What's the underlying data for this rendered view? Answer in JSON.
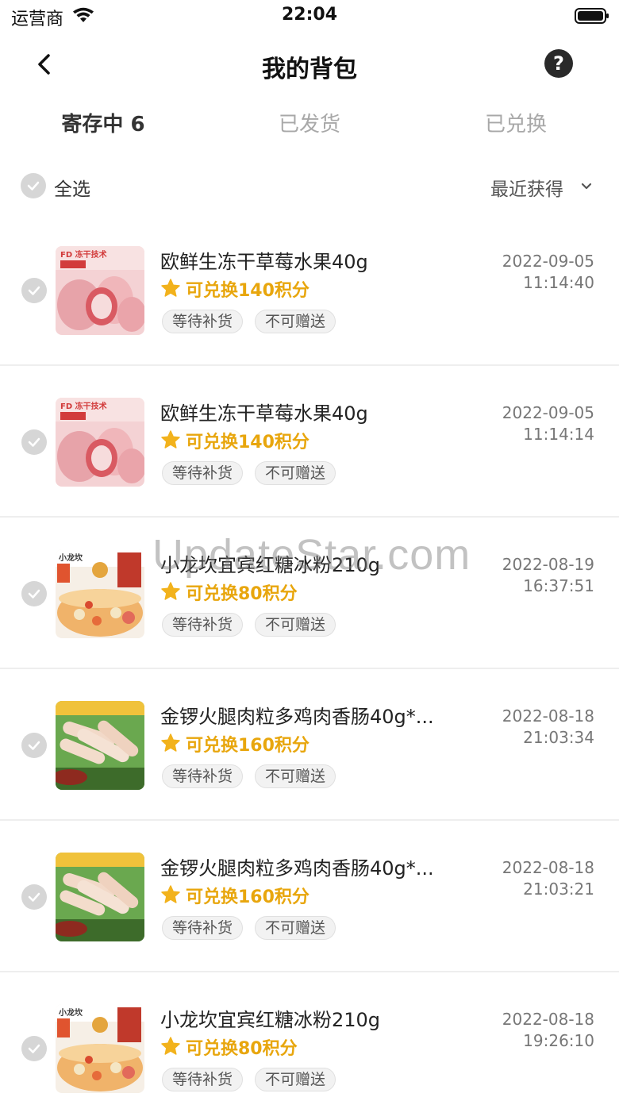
{
  "status_bar": {
    "carrier": "运营商",
    "time": "22:04"
  },
  "nav": {
    "title": "我的背包",
    "help_glyph": "?"
  },
  "tabs": [
    {
      "label": "寄存中 6",
      "active": true
    },
    {
      "label": "已发货",
      "active": false
    },
    {
      "label": "已兑换",
      "active": false
    }
  ],
  "toolbar": {
    "select_all": "全选",
    "sort": "最近获得"
  },
  "items": [
    {
      "title": "欧鲜生冻干草莓水果40g",
      "points": "可兑换140积分",
      "tags": [
        "等待补货",
        "不可赠送"
      ],
      "date": "2022-09-05",
      "time": "11:14:40",
      "image": "strawberry"
    },
    {
      "title": "欧鲜生冻干草莓水果40g",
      "points": "可兑换140积分",
      "tags": [
        "等待补货",
        "不可赠送"
      ],
      "date": "2022-09-05",
      "time": "11:14:14",
      "image": "strawberry"
    },
    {
      "title": "小龙坎宜宾红糖冰粉210g",
      "points": "可兑换80积分",
      "tags": [
        "等待补货",
        "不可赠送"
      ],
      "date": "2022-08-19",
      "time": "16:37:51",
      "image": "jelly"
    },
    {
      "title": "金锣火腿肉粒多鸡肉香肠40g*...",
      "points": "可兑换160积分",
      "tags": [
        "等待补货",
        "不可赠送"
      ],
      "date": "2022-08-18",
      "time": "21:03:34",
      "image": "sausage"
    },
    {
      "title": "金锣火腿肉粒多鸡肉香肠40g*...",
      "points": "可兑换160积分",
      "tags": [
        "等待补货",
        "不可赠送"
      ],
      "date": "2022-08-18",
      "time": "21:03:21",
      "image": "sausage"
    },
    {
      "title": "小龙坎宜宾红糖冰粉210g",
      "points": "可兑换80积分",
      "tags": [
        "等待补货",
        "不可赠送"
      ],
      "date": "2022-08-18",
      "time": "19:26:10",
      "image": "jelly"
    }
  ],
  "watermark": "UpdateStar.com",
  "colors": {
    "points": "#e8a60d",
    "check": "#d6d6d6",
    "tab_active": "#333333",
    "tab_inactive": "#a8a8a8"
  }
}
